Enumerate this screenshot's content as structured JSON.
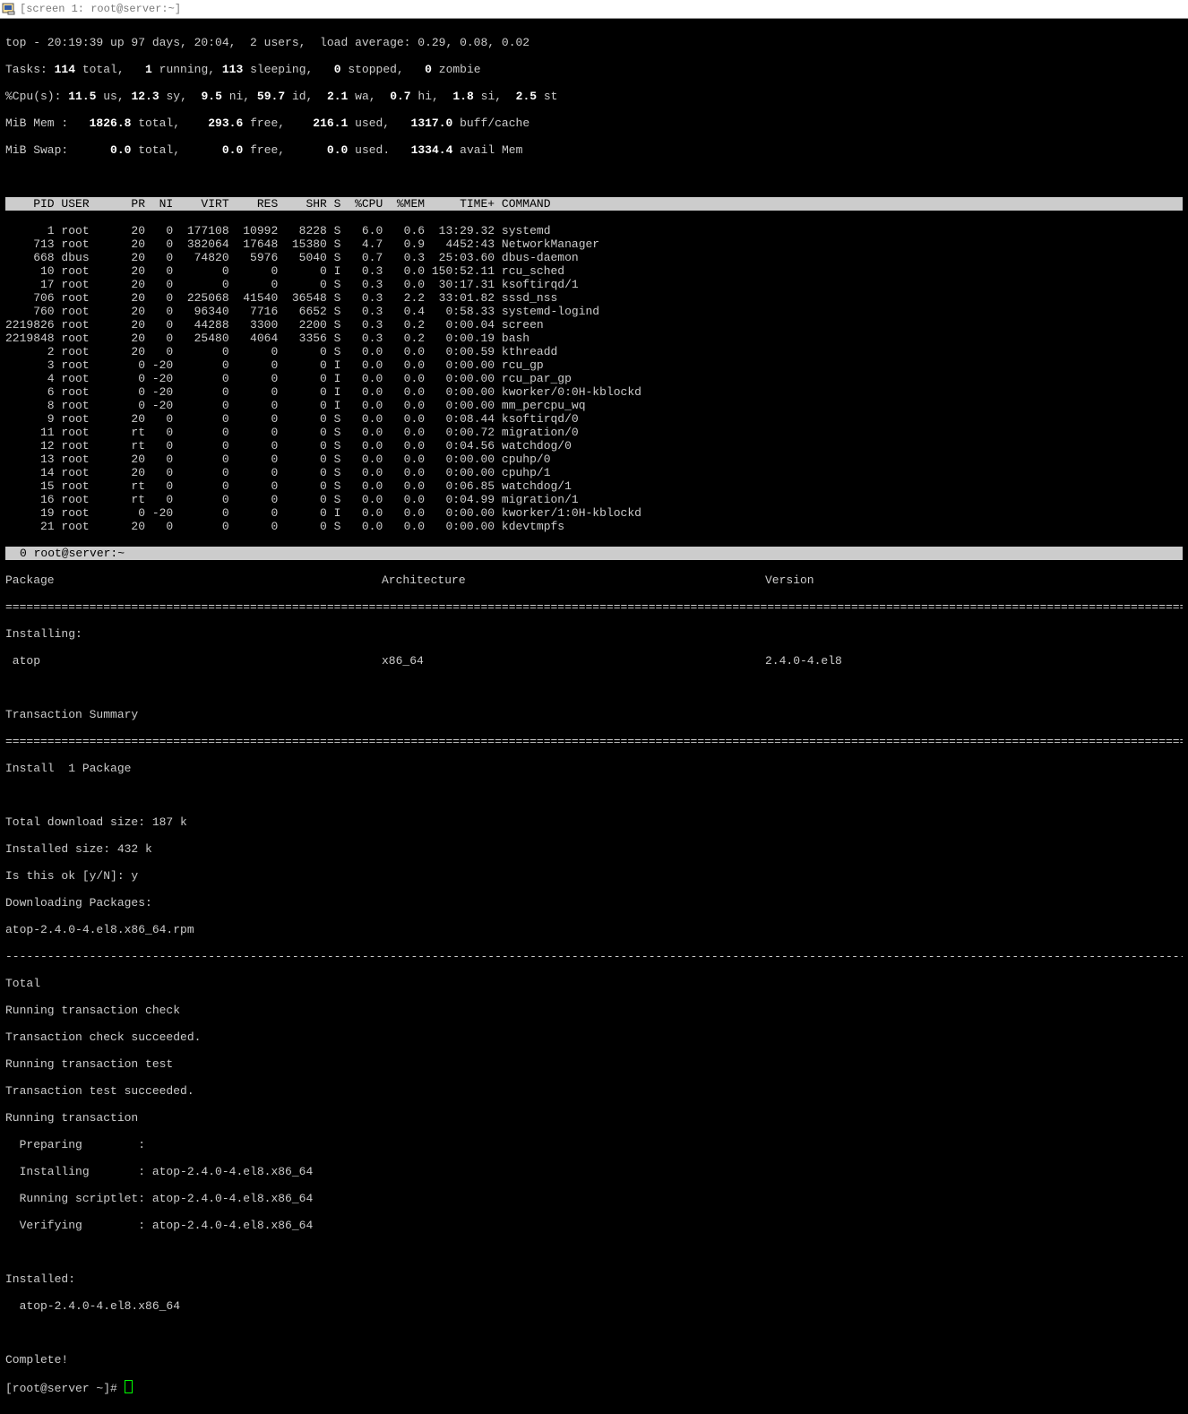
{
  "window": {
    "title": "[screen 1: root@server:~]"
  },
  "top": {
    "summary": {
      "line1": "top - 20:19:39 up 97 days, 20:04,  2 users,  load average: 0.29, 0.08, 0.02",
      "tasks_pre": "Tasks: ",
      "tasks_total": "114 ",
      "tasks_post1": "total,   ",
      "tasks_run": "1 ",
      "tasks_post2": "running, ",
      "tasks_sleep": "113 ",
      "tasks_post3": "sleeping,   ",
      "tasks_stop": "0 ",
      "tasks_post4": "stopped,   ",
      "tasks_zomb": "0 ",
      "tasks_post5": "zombie",
      "cpu_pre": "%Cpu(s): ",
      "cpu_us": "11.5 ",
      "cpu_l1": "us, ",
      "cpu_sy": "12.3 ",
      "cpu_l2": "sy,  ",
      "cpu_ni": "9.5 ",
      "cpu_l3": "ni, ",
      "cpu_id": "59.7 ",
      "cpu_l4": "id,  ",
      "cpu_wa": "2.1 ",
      "cpu_l5": "wa,  ",
      "cpu_hi": "0.7 ",
      "cpu_l6": "hi,  ",
      "cpu_si": "1.8 ",
      "cpu_l7": "si,  ",
      "cpu_st": "2.5 ",
      "cpu_l8": "st",
      "mem_pre": "MiB Mem :   ",
      "mem_total": "1826.8 ",
      "mem_l1": "total,    ",
      "mem_free": "293.6 ",
      "mem_l2": "free,    ",
      "mem_used": "216.1 ",
      "mem_l3": "used,   ",
      "mem_buff": "1317.0 ",
      "mem_l4": "buff/cache",
      "swp_pre": "MiB Swap:      ",
      "swp_total": "0.0 ",
      "swp_l1": "total,      ",
      "swp_free": "0.0 ",
      "swp_l2": "free,      ",
      "swp_used": "0.0 ",
      "swp_l3": "used.   ",
      "swp_avail": "1334.4 ",
      "swp_l4": "avail Mem"
    },
    "header": "    PID USER      PR  NI    VIRT    RES    SHR S  %CPU  %MEM     TIME+ COMMAND",
    "rows": [
      "      1 root      20   0  177108  10992   8228 S   6.0   0.6  13:29.32 systemd",
      "    713 root      20   0  382064  17648  15380 S   4.7   0.9   4452:43 NetworkManager",
      "    668 dbus      20   0   74820   5976   5040 S   0.7   0.3  25:03.60 dbus-daemon",
      "     10 root      20   0       0      0      0 I   0.3   0.0 150:52.11 rcu_sched",
      "     17 root      20   0       0      0      0 S   0.3   0.0  30:17.31 ksoftirqd/1",
      "    706 root      20   0  225068  41540  36548 S   0.3   2.2  33:01.82 sssd_nss",
      "    760 root      20   0   96340   7716   6652 S   0.3   0.4   0:58.33 systemd-logind",
      "2219826 root      20   0   44288   3300   2200 S   0.3   0.2   0:00.04 screen",
      "2219848 root      20   0   25480   4064   3356 S   0.3   0.2   0:00.19 bash",
      "      2 root      20   0       0      0      0 S   0.0   0.0   0:00.59 kthreadd",
      "      3 root       0 -20       0      0      0 I   0.0   0.0   0:00.00 rcu_gp",
      "      4 root       0 -20       0      0      0 I   0.0   0.0   0:00.00 rcu_par_gp",
      "      6 root       0 -20       0      0      0 I   0.0   0.0   0:00.00 kworker/0:0H-kblockd",
      "      8 root       0 -20       0      0      0 I   0.0   0.0   0:00.00 mm_percpu_wq",
      "      9 root      20   0       0      0      0 S   0.0   0.0   0:08.44 ksoftirqd/0",
      "     11 root      rt   0       0      0      0 S   0.0   0.0   0:00.72 migration/0",
      "     12 root      rt   0       0      0      0 S   0.0   0.0   0:04.56 watchdog/0",
      "     13 root      20   0       0      0      0 S   0.0   0.0   0:00.00 cpuhp/0",
      "     14 root      20   0       0      0      0 S   0.0   0.0   0:00.00 cpuhp/1",
      "     15 root      rt   0       0      0      0 S   0.0   0.0   0:06.85 watchdog/1",
      "     16 root      rt   0       0      0      0 S   0.0   0.0   0:04.99 migration/1",
      "     19 root       0 -20       0      0      0 I   0.0   0.0   0:00.00 kworker/1:0H-kblockd",
      "     21 root      20   0       0      0      0 S   0.0   0.0   0:00.00 kdevtmpfs"
    ]
  },
  "screen_status": "0 root@server:~",
  "pkg": {
    "hdr_package": "Package",
    "hdr_arch": "Architecture",
    "hdr_version": "Version",
    "installing": "Installing:",
    "name": " atop",
    "arch": "x86_64",
    "version": "2.4.0-4.el8",
    "txn_summary": "Transaction Summary",
    "install_count": "Install  1 Package",
    "dl_size": "Total download size: 187 k",
    "inst_size": "Installed size: 432 k",
    "prompt": "Is this ok [y/N]: y",
    "downloading": "Downloading Packages:",
    "rpm": "atop-2.4.0-4.el8.x86_64.rpm",
    "total": "Total",
    "l1": "Running transaction check",
    "l2": "Transaction check succeeded.",
    "l3": "Running transaction test",
    "l4": "Transaction test succeeded.",
    "l5": "Running transaction",
    "l6": "  Preparing        :",
    "l7": "  Installing       : atop-2.4.0-4.el8.x86_64",
    "l8": "  Running scriptlet: atop-2.4.0-4.el8.x86_64",
    "l9": "  Verifying        : atop-2.4.0-4.el8.x86_64",
    "installed": "Installed:",
    "installed_pkg": "  atop-2.4.0-4.el8.x86_64",
    "complete": "Complete!",
    "shell_prompt": "[root@server ~]# "
  }
}
